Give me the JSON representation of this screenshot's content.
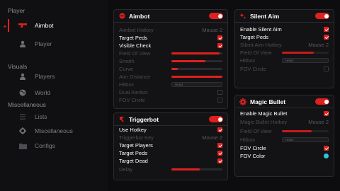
{
  "sidebar": {
    "sections": [
      {
        "title": "Player",
        "items": [
          {
            "label": "Aimbot",
            "icon": "gun-icon",
            "active": true
          },
          {
            "label": "Player",
            "icon": "person-icon",
            "active": false
          }
        ]
      },
      {
        "title": "Visuals",
        "items": [
          {
            "label": "Players",
            "icon": "user-icon",
            "active": false
          },
          {
            "label": "World",
            "icon": "globe-icon",
            "active": false
          }
        ]
      },
      {
        "title": "Miscellaneous",
        "items": [
          {
            "label": "Lists",
            "icon": "list-icon",
            "active": false
          },
          {
            "label": "Miscellaneous",
            "icon": "gear-icon",
            "active": false
          },
          {
            "label": "Configs",
            "icon": "folder-icon",
            "active": false
          }
        ]
      }
    ]
  },
  "aimbot": {
    "title": "Aimbot",
    "hotkey_label": "Aimbot Hotkey",
    "hotkey_value": "Mouse 2",
    "target_peds": "Target Peds",
    "visible_check": "Visible Check",
    "field_of_view": "Field Of View",
    "field_of_view_value": 0.95,
    "smoth": "Smoth",
    "smoth_value": 0.67,
    "curve": "Curve",
    "curve_value": 0.12,
    "aim_distance": "Aim Distance",
    "aim_distance_value": 1.0,
    "hitbox": "Hitbox",
    "hitbox_value": "Head",
    "dual_aimbot": "Dual Aimbot",
    "fov_circle": "FOV Circle"
  },
  "triggerbot": {
    "title": "Triggerbot",
    "use_hotkey": "Use Hotkey",
    "key_label": "Triggerbot Key",
    "key_value": "Mouse 2",
    "target_players": "Target Players",
    "target_peds": "Target Peds",
    "target_dead": "Target Dead",
    "delay": "Delay",
    "delay_value": 0.56
  },
  "silent_aim": {
    "title": "Silent Aim",
    "enable": "Enable Silent Aim",
    "target_peds": "Target Peds",
    "hotkey_label": "Silent Aim Hotkey",
    "hotkey_value": "Mouse 2",
    "field_of_view": "Field Of View",
    "field_of_view_value": 0.68,
    "hitbox": "Hitbox",
    "hitbox_value": "Head",
    "fov_circle": "FOV Circle"
  },
  "magic_bullet": {
    "title": "Magic Bullet",
    "enable": "Enable Magic Bullet",
    "hotkey_label": "Magic Bullet Hotkey",
    "hotkey_value": "Mouse 2",
    "field_of_view": "Field Of View",
    "field_of_view_value": 0.64,
    "hitbox": "Hitbox",
    "hitbox_value": "Head",
    "fov_circle": "FOV Circle",
    "fov_color": "FOV Color",
    "fov_color_hex": "#2ec7d9"
  },
  "colors": {
    "accent": "#e0201e",
    "background": "#0d0d0f",
    "panel": "#131315"
  }
}
